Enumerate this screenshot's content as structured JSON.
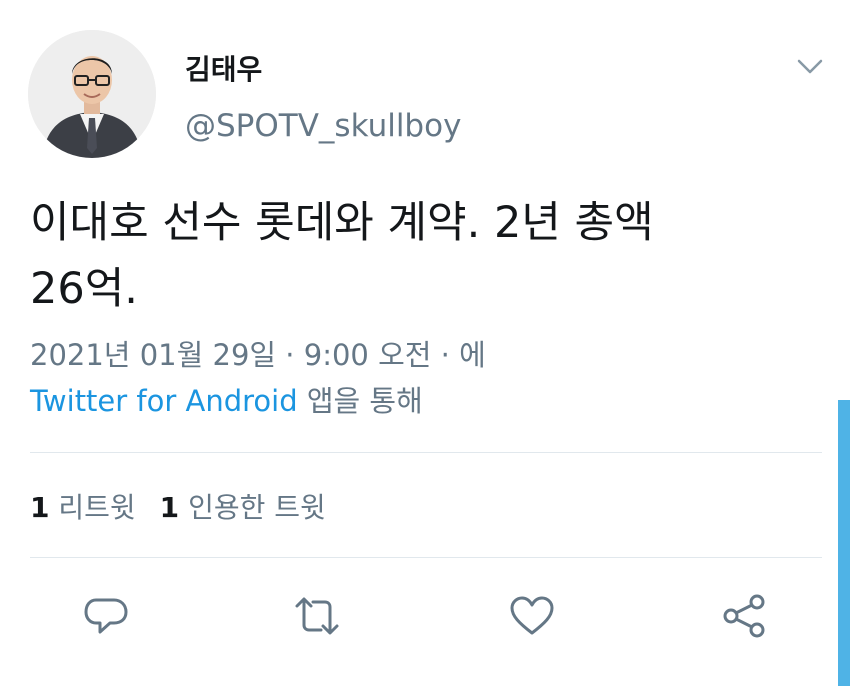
{
  "author": {
    "display_name": "김태우",
    "handle": "@SPOTV_skullboy"
  },
  "tweet": {
    "text": "이대호 선수 롯데와 계약. 2년 총액\n26억.",
    "timestamp": "2021년 01월 29일 · 9:00 오전 · 에",
    "source_link": "Twitter for Android",
    "source_suffix": " 앱을 통해"
  },
  "stats": {
    "retweets_count": "1",
    "retweets_label": "리트윗",
    "quotes_count": "1",
    "quotes_label": "인용한 트윗"
  },
  "icons": {
    "reply": "reply-icon",
    "retweet": "retweet-icon",
    "like": "heart-icon",
    "share": "share-icon",
    "menu": "chevron-down-icon"
  },
  "colors": {
    "accent": "#1b95e0",
    "secondary_text": "#657786",
    "primary_text": "#14171a",
    "divider": "#e1e8ed"
  }
}
